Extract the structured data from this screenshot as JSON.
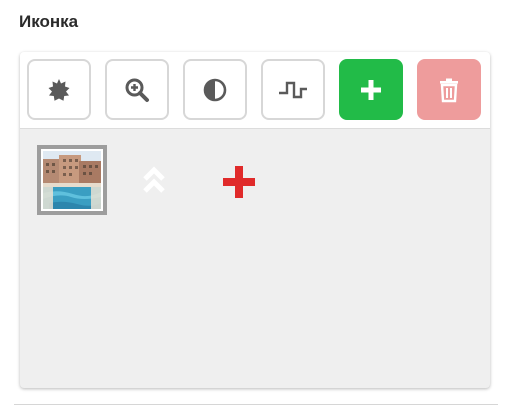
{
  "section": {
    "title": "Иконка"
  },
  "toolbar": {
    "buttons": [
      {
        "name": "settings",
        "icon": "gear-burst-icon"
      },
      {
        "name": "zoom",
        "icon": "zoom-in-icon"
      },
      {
        "name": "contrast",
        "icon": "contrast-icon"
      },
      {
        "name": "signal",
        "icon": "square-wave-icon"
      },
      {
        "name": "add",
        "icon": "plus-icon"
      },
      {
        "name": "delete",
        "icon": "trash-icon"
      }
    ]
  },
  "colors": {
    "add_button": "#22bb48",
    "delete_button": "#ee9c9c",
    "plus_marker": "#e02a2a",
    "panel_bg": "#efefef"
  },
  "items": [
    {
      "image": "hotel-pool-thumbnail",
      "move_icon": "double-chevron-up-icon",
      "action_icon": "red-plus-icon"
    }
  ]
}
